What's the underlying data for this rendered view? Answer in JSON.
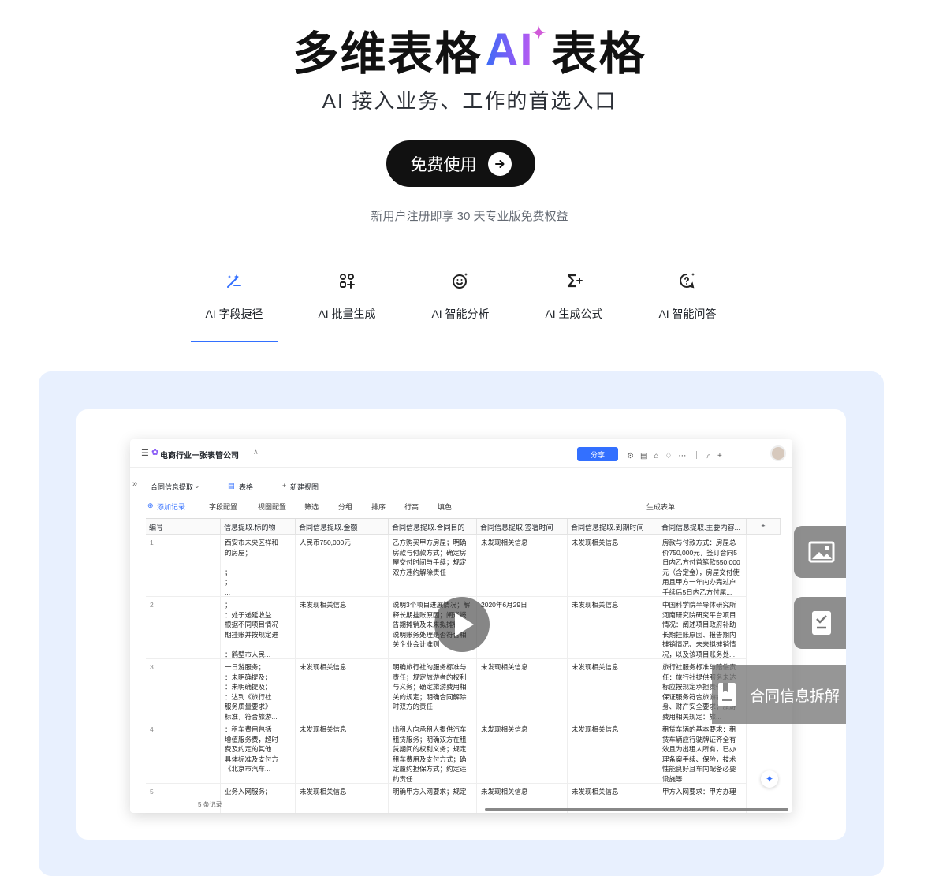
{
  "hero": {
    "title_main": "多维表格",
    "title_ai": "AI",
    "title_tail": "表格",
    "subtitle": "AI 接入业务、工作的首选入口",
    "cta_label": "免费使用",
    "note": "新用户注册即享 30 天专业版免费权益"
  },
  "tabs": [
    {
      "label": "AI 字段捷径",
      "icon": "wand-icon",
      "active": true
    },
    {
      "label": "AI 批量生成",
      "icon": "grid-sparkle-icon",
      "active": false
    },
    {
      "label": "AI 智能分析",
      "icon": "smile-sparkle-icon",
      "active": false
    },
    {
      "label": "AI 生成公式",
      "icon": "sigma-icon",
      "active": false
    },
    {
      "label": "AI 智能问答",
      "icon": "question-sparkle-icon",
      "active": false
    }
  ],
  "app": {
    "doc_title": "电商行业一张表管公司",
    "share_label": "分享",
    "view_name": "合同信息提取",
    "table_tab": "表格",
    "new_view": "新建视图",
    "toolbar": {
      "add_record": "添加记录",
      "field_config": "字段配置",
      "view_config": "视图配置",
      "filter": "筛选",
      "group": "分组",
      "sort": "排序",
      "row_height": "行高",
      "fill": "填色",
      "generate_form": "生成表单"
    },
    "columns": [
      "编号",
      "信息提取.标的物",
      "合同信息提取.金额",
      "合同信息提取.合同目的",
      "合同信息提取.签署时间",
      "合同信息提取.到期时间",
      "合同信息提取.主要内容..."
    ],
    "rows": [
      {
        "num": "1",
        "c1": "西安市未央区祥和\n的房屋；\n\n；\n；\n...",
        "c2": "人民币750,000元",
        "c3": "乙方购买甲方房屋；明确房款与付款方式；确定房屋交付时间与手续；规定双方违约解除责任",
        "c4": "未发现相关信息",
        "c5": "未发现相关信息",
        "c6": "房款与付款方式：房屋总价750,000元，签订合同5日内乙方付首笔款550,000元（含定金），房屋交付使用且甲方一年内办完过户手续后5日内乙方付尾..."
      },
      {
        "num": "2",
        "c1": "；\n：处于递延收益\n根据不同项目情况\n期挂账并按规定进\n\n：鹤壁市人民...",
        "c2": "未发现相关信息",
        "c3": "说明3个项目进展情况；解释长期挂账原因；阐述报告期摊销及未来拟摊销；说明账务处理是否符合相关企业会计准则",
        "c4": "2020年6月29日",
        "c5": "未发现相关信息",
        "c6": "中国科学院半导体研究所河南研究院研究平台项目情况：阐述项目政府补助长期挂账原因、报告期内摊销情况、未来拟摊销情况，以及该项目账务处..."
      },
      {
        "num": "3",
        "c1": "一日游服务；\n：未明确提及；\n：未明确提及；\n：达到《旅行社\n服务质量要求》\n标准，符合旅游...",
        "c2": "未发现相关信息",
        "c3": "明确旅行社的服务标准与责任；规定旅游者的权利与义务；确定旅游费用相关的规定；明确合同解除时双方的责任",
        "c4": "未发现相关信息",
        "c5": "未发现相关信息",
        "c6": "旅行社服务标准与赔偿责任：旅行社提供服务未达标应按规定承担责任，应保证服务符合旅游者人身、财产安全要求；旅游费用相关规定：旅..."
      },
      {
        "num": "4",
        "c1": "：租车费用包括\n增值服务费，超时\n费及约定的其他\n具体标准及支付方\n《北京市汽车...",
        "c2": "未发现相关信息",
        "c3": "出租人向承租人提供汽车租赁服务；明确双方在租赁期间的权利义务；规定租车费用及支付方式；确定履约担保方式；约定违约责任",
        "c4": "未发现相关信息",
        "c5": "未发现相关信息",
        "c6": "租赁车辆的基本要求：租赁车辆应行驶牌证齐全有效且为出租人所有，已办理备案手续、保险，技术性能良好且车内配备必要设施等..."
      },
      {
        "num": "5",
        "c1": "业务入网服务；",
        "c2": "未发现相关信息",
        "c3": "明确甲方入网要求；规定",
        "c4": "未发现相关信息",
        "c5": "未发现相关信息",
        "c6": "甲方入网要求：甲方办理"
      }
    ],
    "record_count": "5 条记录",
    "contract_label": "合同信息拆解"
  }
}
